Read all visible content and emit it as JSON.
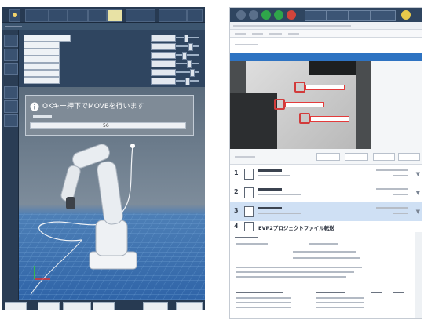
{
  "left_panel": {
    "dialog_message": "OKキー押下でMOVEを行います",
    "progress_value": "56"
  },
  "right_panel": {
    "flow_steps": [
      {
        "number": "1"
      },
      {
        "number": "2"
      },
      {
        "number": "3"
      },
      {
        "number": "4",
        "title": "EVP2プロジェクトファイル転送"
      }
    ]
  },
  "colors": {
    "tablet_bg": "#2f4560",
    "floor_blue": "#2f64a8",
    "accent_blue": "#2e73c2",
    "selection": "#cfe0f4"
  }
}
